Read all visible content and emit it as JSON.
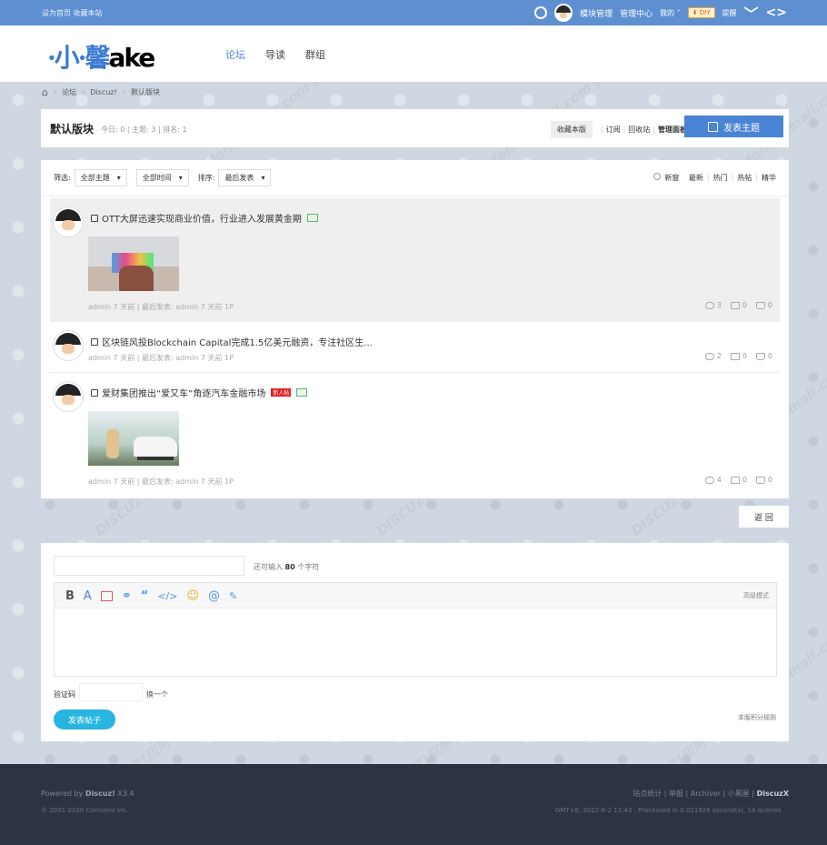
{
  "topbar": {
    "left_links": "设为首页 收藏本站",
    "items": [
      "模块管理",
      "管理中心",
      "我的 ˅",
      "DIY",
      "提醒"
    ]
  },
  "header": {
    "logo_main": "·小·馨",
    "logo_tail": "ake",
    "nav": [
      "论坛",
      "导读",
      "群组"
    ]
  },
  "breadcrumb": [
    "论坛",
    "Discuz!",
    "默认版块"
  ],
  "forum": {
    "title": "默认版块",
    "stats": "今日: 0  |  主题: 3  |  排名: 1",
    "favorite": "收藏本版",
    "subscribe": "订阅",
    "recycle": "回收站",
    "manage": "管理面板",
    "post_new": "发表主题"
  },
  "filters": {
    "label": "筛选:",
    "topic": "全部主题",
    "time": "全部时间",
    "sort_label": "排序:",
    "sort": "最后发表",
    "new_window": "新窗",
    "tabs": [
      "最新",
      "热门",
      "热帖",
      "精华"
    ]
  },
  "threads": [
    {
      "title": "OTT大屏迅速实现商业价值，行业进入发展黄金期",
      "meta": "admin  7 天前  |  最后发表: admin 7 天前  1P",
      "views": "3",
      "replies": "0",
      "likes": "0",
      "new_badge": ""
    },
    {
      "title": "区块链风投Blockchain Capital完成1.5亿美元融资，专注社区生...",
      "meta": "admin  7 天前  |  最后发表: admin 7 天前  1P",
      "views": "2",
      "replies": "0",
      "likes": "0",
      "new_badge": ""
    },
    {
      "title": "爱财集团推出“爱又车”角逐汽车金融市场",
      "meta": "admin  7 天前  |  最后发表: admin 7 天前  1P",
      "views": "4",
      "replies": "0",
      "likes": "0",
      "new_badge": "新人帖"
    }
  ],
  "back": "返 回",
  "reply": {
    "remain_prefix": "还可输入",
    "remain_count": "80",
    "remain_suffix": "个字符",
    "advanced": "高级模式",
    "captcha_label": "验证码",
    "change": "换一个",
    "submit": "发表帖子",
    "rules": "本版积分规则"
  },
  "footer": {
    "powered_prefix": "Powered by",
    "powered_brand": "Discuz!",
    "powered_version": "X3.4",
    "copyright": "© 2001-2020 Comsenz Inc.",
    "links": "站点统计  |  举报  |  Archiver  |  小黑屋  |",
    "brand": "DiscuzX",
    "runtime": "GMT+8, 2022-6-2 11:43 , Processed in 0.021926 second(s), 14 queries ."
  },
  "watermark": "DISCUZ!应用中心 addon.dismall.com | 贰道"
}
